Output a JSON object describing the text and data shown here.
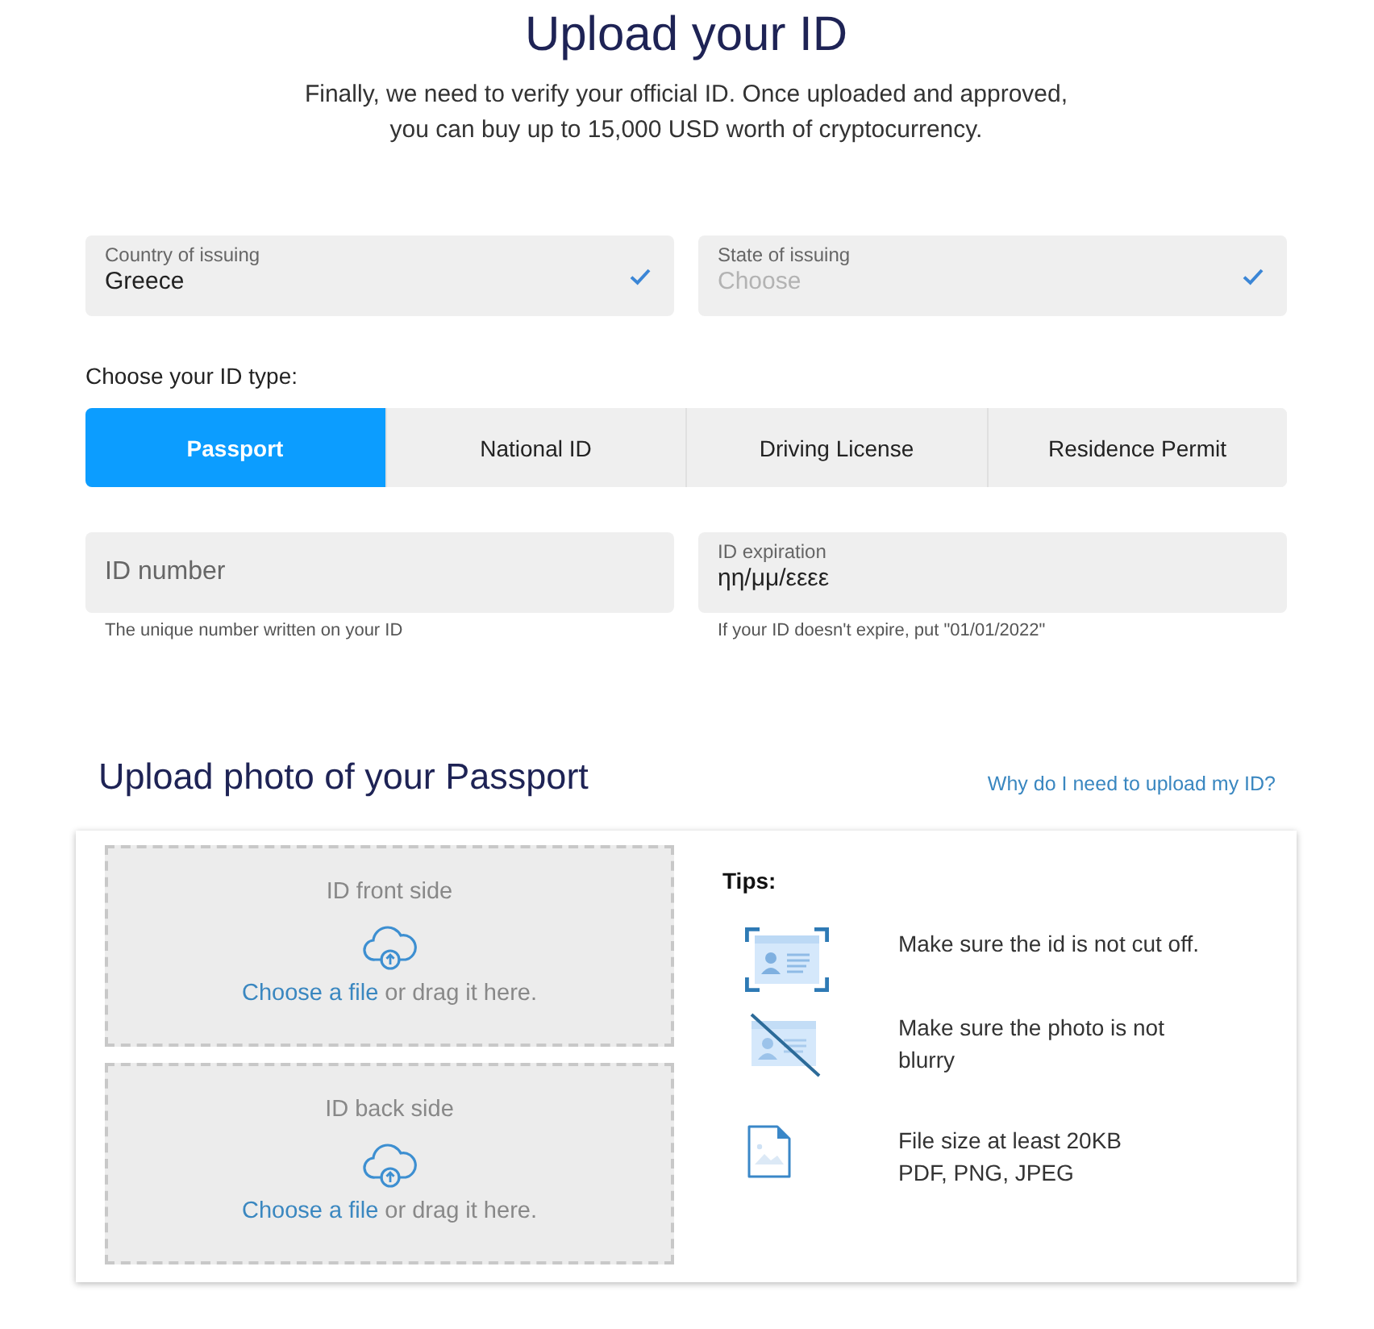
{
  "header": {
    "title": "Upload your ID",
    "description": "Finally, we need to verify your official ID. Once uploaded and approved, you can buy up to 15,000 USD worth of cryptocurrency."
  },
  "issuing_fields": [
    {
      "label": "Country of issuing",
      "value": "Greece",
      "valid": true
    },
    {
      "label": "State of issuing",
      "placeholder": "Choose",
      "valid": true
    }
  ],
  "id_type": {
    "label": "Choose your ID type:",
    "tabs": [
      {
        "label": "Passport",
        "selected": true
      },
      {
        "label": "National ID",
        "selected": false
      },
      {
        "label": "Driving License",
        "selected": false
      },
      {
        "label": "Residence Permit",
        "selected": false
      }
    ]
  },
  "id_fields": [
    {
      "placeholder": "ID number",
      "hint": "The unique number written on your ID"
    },
    {
      "label": "ID expiration",
      "value": "ηη/μμ/εεεε",
      "hint": "If your ID doesn't expire, put \"01/01/2022\""
    }
  ],
  "upload": {
    "title": "Upload photo of your Passport",
    "help_link": "Why do I need to upload my ID?",
    "dropzones": [
      {
        "label": "ID front side",
        "link": "Choose a file",
        "text": "or drag it here."
      },
      {
        "label": "ID back side",
        "link": "Choose a file",
        "text": "or drag it here."
      }
    ],
    "tips": {
      "title": "Tips:",
      "items": [
        {
          "kind": "framed-card",
          "text": "Make sure the id is not cut off."
        },
        {
          "kind": "crossed-card",
          "text": "Make sure the photo is not\nblurry"
        },
        {
          "kind": "file",
          "text": "File size at least 20KB\nPDF, PNG, JPEG"
        }
      ]
    }
  }
}
